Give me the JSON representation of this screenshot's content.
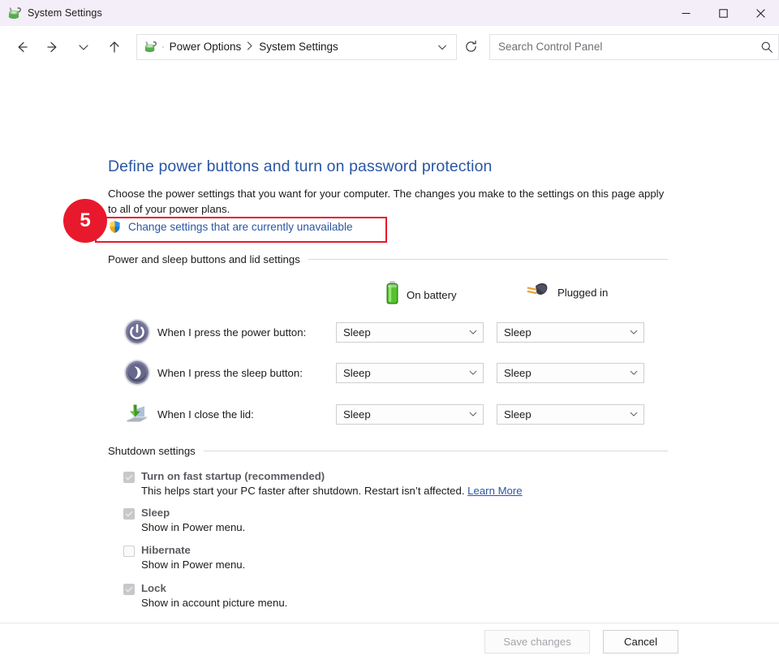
{
  "window": {
    "title": "System Settings",
    "icon": "power-options-icon",
    "controls": {
      "minimize": "minimize-icon",
      "maximize": "maximize-icon",
      "close": "close-icon"
    }
  },
  "navbar": {
    "back": "back-arrow-icon",
    "forward": "forward-arrow-icon",
    "recent": "chevron-down-icon",
    "up": "up-arrow-icon",
    "breadcrumb": {
      "icon": "power-options-icon",
      "separator_dot": "·",
      "items": [
        "Power Options",
        "System Settings"
      ],
      "chevron": "chevron-down-icon"
    },
    "refresh": "refresh-icon",
    "search": {
      "placeholder": "Search Control Panel",
      "value": "",
      "icon": "search-icon"
    }
  },
  "page": {
    "title": "Define power buttons and turn on password protection",
    "description": "Choose the power settings that you want for your computer. The changes you make to the settings on this page apply to all of your power plans.",
    "elevate_link": "Change settings that are currently unavailable",
    "elevate_shield_icon": "uac-shield-icon",
    "annotation": {
      "step_number": "5",
      "badge_color": "#e8192c",
      "highlight_color": "#e8192c"
    }
  },
  "power_section": {
    "heading": "Power and sleep buttons and lid settings",
    "columns": [
      {
        "label": "On battery",
        "icon": "battery-icon"
      },
      {
        "label": "Plugged in",
        "icon": "power-plug-icon"
      }
    ],
    "rows": [
      {
        "icon": "power-button-icon",
        "label": "When I press the power button:",
        "on_battery": "Sleep",
        "plugged_in": "Sleep"
      },
      {
        "icon": "sleep-button-icon",
        "label": "When I press the sleep button:",
        "on_battery": "Sleep",
        "plugged_in": "Sleep"
      },
      {
        "icon": "laptop-lid-icon",
        "label": "When I close the lid:",
        "on_battery": "Sleep",
        "plugged_in": "Sleep"
      }
    ]
  },
  "shutdown_section": {
    "heading": "Shutdown settings",
    "items": [
      {
        "label": "Turn on fast startup (recommended)",
        "checked": true,
        "sub": "This helps start your PC faster after shutdown. Restart isn’t affected.",
        "link": "Learn More"
      },
      {
        "label": "Sleep",
        "checked": true,
        "sub": "Show in Power menu.",
        "link": ""
      },
      {
        "label": "Hibernate",
        "checked": false,
        "sub": "Show in Power menu.",
        "link": ""
      },
      {
        "label": "Lock",
        "checked": true,
        "sub": "Show in account picture menu.",
        "link": ""
      }
    ]
  },
  "footer": {
    "save_label": "Save changes",
    "save_disabled": true,
    "cancel_label": "Cancel"
  },
  "colors": {
    "title_link": "#2b57a4",
    "titlebar_bg": "#f3eef7",
    "accent_red": "#e8192c"
  }
}
